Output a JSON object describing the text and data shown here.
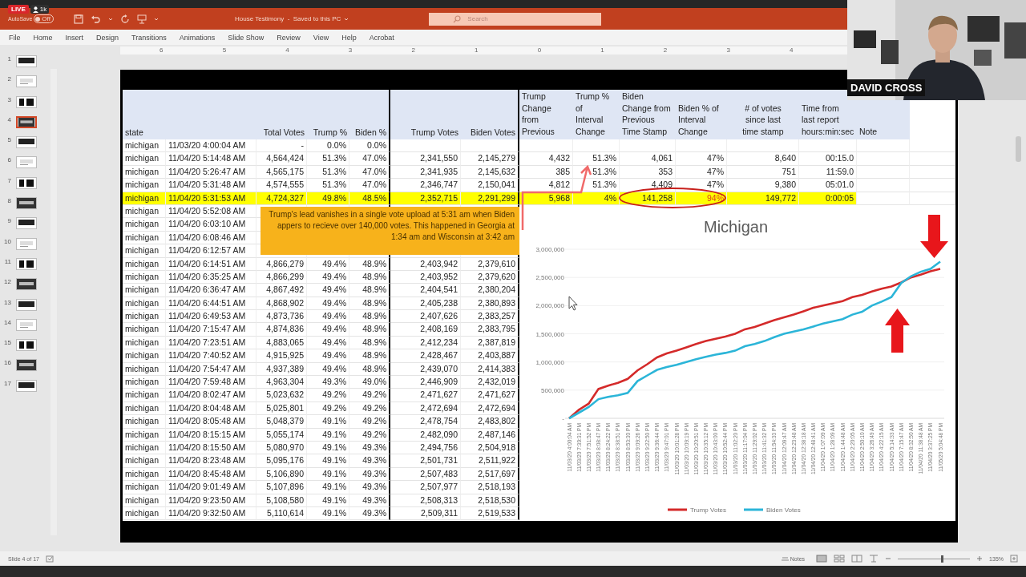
{
  "live_badge": {
    "label": "LIVE",
    "viewers": "1k"
  },
  "title_bar": {
    "autosave_label": "AutoSave",
    "autosave_toggle": {
      "label": "Off",
      "on": false
    },
    "title": "House Testimony  -  Saved to this PC",
    "search_placeholder": "Search"
  },
  "ribbon_tabs": [
    {
      "label": "File",
      "selected": false
    },
    {
      "label": "Home",
      "selected": false
    },
    {
      "label": "Insert",
      "selected": false
    },
    {
      "label": "Design",
      "selected": false
    },
    {
      "label": "Transitions",
      "selected": false
    },
    {
      "label": "Animations",
      "selected": false
    },
    {
      "label": "Slide Show",
      "selected": false
    },
    {
      "label": "Review",
      "selected": false
    },
    {
      "label": "View",
      "selected": false
    },
    {
      "label": "Help",
      "selected": false
    },
    {
      "label": "Acrobat",
      "selected": false
    }
  ],
  "slides": [
    {
      "number": "1",
      "selected": false
    },
    {
      "number": "2",
      "selected": false
    },
    {
      "number": "3",
      "selected": false
    },
    {
      "number": "4",
      "selected": true
    },
    {
      "number": "5",
      "selected": false
    },
    {
      "number": "6",
      "selected": false
    },
    {
      "number": "7",
      "selected": false
    },
    {
      "number": "8",
      "selected": false
    },
    {
      "number": "9",
      "selected": false
    },
    {
      "number": "10",
      "selected": false
    },
    {
      "number": "11",
      "selected": false
    },
    {
      "number": "12",
      "selected": false
    },
    {
      "number": "13",
      "selected": false
    },
    {
      "number": "14",
      "selected": false
    },
    {
      "number": "15",
      "selected": false
    },
    {
      "number": "16",
      "selected": false
    },
    {
      "number": "17",
      "selected": false
    }
  ],
  "ruler_marks": [
    "6",
    "5",
    "4",
    "3",
    "2",
    "1",
    "0",
    "1",
    "2",
    "3",
    "4"
  ],
  "slide": {
    "table": {
      "left_columns": [
        {
          "kind": "text",
          "label": "state"
        },
        {
          "kind": "text"
        },
        {
          "kind": "number",
          "label": "Total Votes"
        },
        {
          "kind": "number",
          "label": "Trump %"
        },
        {
          "kind": "number",
          "label": "Biden %"
        },
        {
          "kind": "number",
          "label": "Trump Votes"
        },
        {
          "kind": "number",
          "label": "Biden Votes"
        }
      ],
      "right_columns": [
        {
          "kind": "text",
          "label": "Trump\nChange\nfrom\nPrevious"
        },
        {
          "kind": "text",
          "label": "Trump %\nof\nInterval\nChange"
        },
        {
          "kind": "text",
          "label": "Biden\nChange from\nPrevious\nTime Stamp"
        },
        {
          "kind": "text",
          "label": "Biden % of\nInterval\nChange"
        },
        {
          "kind": "center",
          "label": "# of votes\nsince last\ntime stamp"
        },
        {
          "kind": "text",
          "label": "Time from\nlast report\nhours:min:sec"
        },
        {
          "kind": "text",
          "label": "Note"
        }
      ],
      "rows": [
        {
          "cells": [
            "michigan",
            "11/03/20 4:00:04 AM",
            "-",
            "0.0%",
            "0.0%"
          ],
          "highlighted": false
        },
        {
          "cells": [
            "michigan",
            "11/04/20 5:14:48 AM",
            "4,564,424",
            "51.3%",
            "47.0%",
            "2,341,550",
            "2,145,279"
          ],
          "changes": [
            "4,432",
            "51.3%",
            "4,061",
            "47%",
            "8,640",
            "00:15.0"
          ],
          "alert": false,
          "highlighted": false
        },
        {
          "cells": [
            "michigan",
            "11/04/20 5:26:47 AM",
            "4,565,175",
            "51.3%",
            "47.0%",
            "2,341,935",
            "2,145,632"
          ],
          "changes": [
            "385",
            "51.3%",
            "353",
            "47%",
            "751",
            "11:59.0"
          ],
          "alert": false,
          "highlighted": false
        },
        {
          "cells": [
            "michigan",
            "11/04/20 5:31:48 AM",
            "4,574,555",
            "51.3%",
            "47.0%",
            "2,346,747",
            "2,150,041"
          ],
          "changes": [
            "4,812",
            "51.3%",
            "4,409",
            "47%",
            "9,380",
            "05:01.0"
          ],
          "alert": false,
          "highlighted": false
        },
        {
          "cells": [
            "michigan",
            "11/04/20 5:31:53 AM",
            "4,724,327",
            "49.8%",
            "48.5%",
            "2,352,715",
            "2,291,299"
          ],
          "changes": [
            "5,968",
            "4%",
            "141,258",
            "94%",
            "149,772",
            "0:00:05"
          ],
          "alert": true,
          "highlighted": true
        },
        {
          "cells": [
            "michigan",
            "11/04/20 5:52:08 AM"
          ],
          "highlighted": false
        },
        {
          "cells": [
            "michigan",
            "11/04/20 6:03:10 AM"
          ],
          "highlighted": false
        },
        {
          "cells": [
            "michigan",
            "11/04/20 6:08:46 AM"
          ],
          "highlighted": false
        },
        {
          "cells": [
            "michigan",
            "11/04/20 6:12:57 AM"
          ],
          "highlighted": false
        },
        {
          "cells": [
            "michigan",
            "11/04/20 6:14:51 AM",
            "4,866,279",
            "49.4%",
            "48.9%",
            "2,403,942",
            "2,379,610"
          ],
          "highlighted": false
        },
        {
          "cells": [
            "michigan",
            "11/04/20 6:35:25 AM",
            "4,866,299",
            "49.4%",
            "48.9%",
            "2,403,952",
            "2,379,620"
          ],
          "highlighted": false
        },
        {
          "cells": [
            "michigan",
            "11/04/20 6:36:47 AM",
            "4,867,492",
            "49.4%",
            "48.9%",
            "2,404,541",
            "2,380,204"
          ],
          "highlighted": false
        },
        {
          "cells": [
            "michigan",
            "11/04/20 6:44:51 AM",
            "4,868,902",
            "49.4%",
            "48.9%",
            "2,405,238",
            "2,380,893"
          ],
          "highlighted": false
        },
        {
          "cells": [
            "michigan",
            "11/04/20 6:49:53 AM",
            "4,873,736",
            "49.4%",
            "48.9%",
            "2,407,626",
            "2,383,257"
          ],
          "highlighted": false
        },
        {
          "cells": [
            "michigan",
            "11/04/20 7:15:47 AM",
            "4,874,836",
            "49.4%",
            "48.9%",
            "2,408,169",
            "2,383,795"
          ],
          "highlighted": false
        },
        {
          "cells": [
            "michigan",
            "11/04/20 7:23:51 AM",
            "4,883,065",
            "49.4%",
            "48.9%",
            "2,412,234",
            "2,387,819"
          ],
          "highlighted": false
        },
        {
          "cells": [
            "michigan",
            "11/04/20 7:40:52 AM",
            "4,915,925",
            "49.4%",
            "48.9%",
            "2,428,467",
            "2,403,887"
          ],
          "highlighted": false
        },
        {
          "cells": [
            "michigan",
            "11/04/20 7:54:47 AM",
            "4,937,389",
            "49.4%",
            "48.9%",
            "2,439,070",
            "2,414,383"
          ],
          "highlighted": false
        },
        {
          "cells": [
            "michigan",
            "11/04/20 7:59:48 AM",
            "4,963,304",
            "49.3%",
            "49.0%",
            "2,446,909",
            "2,432,019"
          ],
          "highlighted": false
        },
        {
          "cells": [
            "michigan",
            "11/04/20 8:02:47 AM",
            "5,023,632",
            "49.2%",
            "49.2%",
            "2,471,627",
            "2,471,627"
          ],
          "highlighted": false
        },
        {
          "cells": [
            "michigan",
            "11/04/20 8:04:48 AM",
            "5,025,801",
            "49.2%",
            "49.2%",
            "2,472,694",
            "2,472,694"
          ],
          "highlighted": false
        },
        {
          "cells": [
            "michigan",
            "11/04/20 8:05:48 AM",
            "5,048,379",
            "49.1%",
            "49.2%",
            "2,478,754",
            "2,483,802"
          ],
          "highlighted": false
        },
        {
          "cells": [
            "michigan",
            "11/04/20 8:15:15 AM",
            "5,055,174",
            "49.1%",
            "49.2%",
            "2,482,090",
            "2,487,146"
          ],
          "highlighted": false
        },
        {
          "cells": [
            "michigan",
            "11/04/20 8:15:50 AM",
            "5,080,970",
            "49.1%",
            "49.3%",
            "2,494,756",
            "2,504,918"
          ],
          "highlighted": false
        },
        {
          "cells": [
            "michigan",
            "11/04/20 8:23:48 AM",
            "5,095,176",
            "49.1%",
            "49.3%",
            "2,501,731",
            "2,511,922"
          ],
          "highlighted": false
        },
        {
          "cells": [
            "michigan",
            "11/04/20 8:45:48 AM",
            "5,106,890",
            "49.1%",
            "49.3%",
            "2,507,483",
            "2,517,697"
          ],
          "highlighted": false
        },
        {
          "cells": [
            "michigan",
            "11/04/20 9:01:49 AM",
            "5,107,896",
            "49.1%",
            "49.3%",
            "2,507,977",
            "2,518,193"
          ],
          "highlighted": false
        },
        {
          "cells": [
            "michigan",
            "11/04/20 9:23:50 AM",
            "5,108,580",
            "49.1%",
            "49.3%",
            "2,508,313",
            "2,518,530"
          ],
          "highlighted": false
        },
        {
          "cells": [
            "michigan",
            "11/04/20 9:32:50 AM",
            "5,110,614",
            "49.1%",
            "49.3%",
            "2,509,311",
            "2,519,533"
          ],
          "highlighted": false
        }
      ]
    },
    "callout": "Trump's lead vanishes in a single vote upload at 5:31 am when Biden appers to recieve over 140,000 votes.  This happened in Georgia at 1:34 am and Wisconsin at 3:42 am",
    "chart": {
      "chart_data": {
        "type": "line",
        "title": "Michigan",
        "categories": [
          "11/03/20 4:00:04 AM",
          "11/03/20 7:39:31 PM",
          "11/03/20 7:51:52 PM",
          "11/03/20 8:08:47 PM",
          "11/03/20 8:24:22 PM",
          "11/03/20 8:38:51 PM",
          "11/03/20 8:53:30 PM",
          "11/03/20 9:09:26 PM",
          "11/03/20 9:22:50 PM",
          "11/03/20 9:36:44 PM",
          "11/03/20 9:47:01 PM",
          "11/03/20 10:01:28 PM",
          "11/03/20 10:09:19 PM",
          "11/03/20 10:20:51 PM",
          "11/03/20 10:35:12 PM",
          "11/03/20 10:43:00 PM",
          "11/03/20 10:52:44 PM",
          "11/03/20 11:02:20 PM",
          "11/03/20 11:17:04 PM",
          "11/03/20 11:29:02 PM",
          "11/03/20 11:41:32 PM",
          "11/03/20 11:54:33 PM",
          "11/04/20 12:09:47 AM",
          "11/04/20 12:23:48 AM",
          "11/04/20 12:38:18 AM",
          "11/04/20 12:48:41 AM",
          "11/04/20 1:07:09 AM",
          "11/04/20 1:28:09 AM",
          "11/04/20 1:44:48 AM",
          "11/04/20 2:20:05 AM",
          "11/04/20 2:50:10 AM",
          "11/04/20 3:26:49 AM",
          "11/04/20 4:22:15 AM",
          "11/04/20 5:14:33 AM",
          "11/04/20 7:15:47 AM",
          "11/04/20 8:32:50 AM",
          "11/04/20 11:38:48 AM",
          "11/04/20 3:37:25 PM",
          "11/05/20 5:04:48 PM"
        ],
        "series": [
          {
            "name": "Trump Votes",
            "color": "#d42a2a",
            "values": [
              0,
              150000,
              260000,
              520000,
              580000,
              630000,
              700000,
              850000,
              960000,
              1080000,
              1150000,
              1200000,
              1260000,
              1320000,
              1370000,
              1410000,
              1450000,
              1500000,
              1580000,
              1620000,
              1680000,
              1740000,
              1790000,
              1840000,
              1900000,
              1960000,
              2000000,
              2040000,
              2080000,
              2150000,
              2190000,
              2250000,
              2300000,
              2340000,
              2410000,
              2500000,
              2550000,
              2610000,
              2650000
            ]
          },
          {
            "name": "Biden Votes",
            "color": "#2bb5d8",
            "values": [
              0,
              100000,
              200000,
              340000,
              380000,
              410000,
              450000,
              660000,
              760000,
              860000,
              910000,
              950000,
              1000000,
              1050000,
              1090000,
              1130000,
              1160000,
              1200000,
              1280000,
              1320000,
              1370000,
              1440000,
              1500000,
              1540000,
              1580000,
              1630000,
              1680000,
              1720000,
              1760000,
              1840000,
              1890000,
              2000000,
              2070000,
              2150000,
              2400000,
              2520000,
              2600000,
              2650000,
              2780000
            ]
          }
        ],
        "ylim": [
          0,
          3000000
        ],
        "grid": true,
        "legend": true,
        "yticks": [
          {
            "value": 0,
            "label": "-"
          },
          {
            "value": 500000,
            "label": "500,000"
          },
          {
            "value": 1000000,
            "label": "1,000,000"
          },
          {
            "value": 1500000,
            "label": "1,500,000"
          },
          {
            "value": 2000000,
            "label": "2,000,000"
          },
          {
            "value": 2500000,
            "label": "2,500,000"
          },
          {
            "value": 3000000,
            "label": "3,000,000"
          }
        ]
      }
    }
  },
  "video": {
    "kind": "picture",
    "name_label": "DAVID CROSS"
  },
  "status_bar": {
    "slide_info": "Slide 4 of 17",
    "notes": "Notes",
    "zoom": "135%",
    "zoom_slider": {
      "level": 0.6
    }
  }
}
